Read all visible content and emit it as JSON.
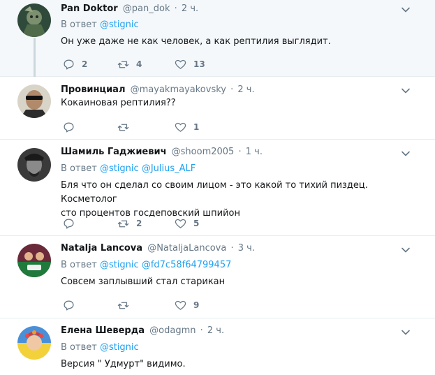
{
  "tweets": [
    {
      "name": "Pan Doktor",
      "handle": "@pan_dok",
      "dot": "·",
      "time": "2 ч.",
      "reply_prefix": "В ответ",
      "reply_to": [
        "@stignic"
      ],
      "text": "Он уже даже не как человек, а как рептилия выглядит.",
      "replies": "2",
      "retweets": "4",
      "likes": "13"
    },
    {
      "name": "Провинциал",
      "handle": "@mayakmayakovsky",
      "dot": "·",
      "time": "2 ч.",
      "text": "Кокаиновая рептилия??",
      "replies": "",
      "retweets": "",
      "likes": "1"
    },
    {
      "name": "Шамиль Гаджиевич",
      "handle": "@shoom2005",
      "dot": "·",
      "time": "1 ч.",
      "reply_prefix": "В ответ",
      "reply_to": [
        "@stignic",
        "@Julius_ALF"
      ],
      "text_lines": [
        "Бля что он сделал со своим лицом -  это какой то тихий пиздец. Косметолог",
        "сто процентов госдеповский шпийон"
      ],
      "replies": "",
      "retweets": "2",
      "likes": "5"
    },
    {
      "name": "Natalja Lancova",
      "handle": "@NataljaLancova",
      "dot": "·",
      "time": "3 ч.",
      "reply_prefix": "В ответ",
      "reply_to": [
        "@stignic",
        "@fd7c58f64799457"
      ],
      "text": "Совсем заплывший стал старикан",
      "replies": "",
      "retweets": "",
      "likes": "9"
    },
    {
      "name": "Елена Шеверда",
      "handle": "@odagmn",
      "dot": "·",
      "time": "2 ч.",
      "reply_prefix": "В ответ",
      "reply_to": [
        "@stignic"
      ],
      "text": "Версия \" Удмурт\" видимо."
    }
  ],
  "colors": {
    "link": "#1da1f2",
    "muted": "#657786",
    "thread_line": "#ccd6dd",
    "highlight_bg": "#f5f8fa"
  },
  "icons": [
    "reply-icon",
    "retweet-icon",
    "like-icon",
    "chevron-down-icon"
  ]
}
